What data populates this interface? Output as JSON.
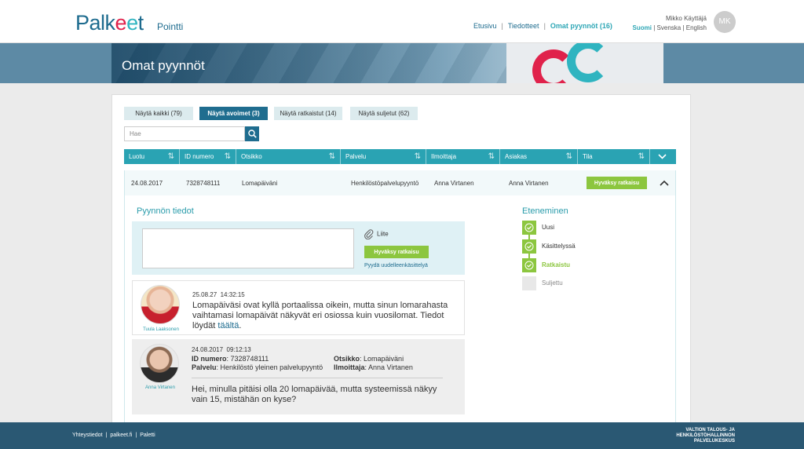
{
  "header": {
    "logo": {
      "part1": "Palk",
      "part2": "e",
      "part3": "e",
      "part4": "t"
    },
    "product": "Pointti",
    "nav": [
      {
        "label": "Etusivu"
      },
      {
        "label": "Tiedotteet"
      },
      {
        "label": "Omat pyynnöt (16)"
      }
    ],
    "user_name": "Mikko Käyttäjä",
    "languages": [
      {
        "label": "Suomi"
      },
      {
        "label": "Svenska"
      },
      {
        "label": "English"
      }
    ],
    "avatar_initials": "MK"
  },
  "banner": {
    "title": "Omat pyynnöt"
  },
  "filters": [
    {
      "label": "Näytä kaikki (79)"
    },
    {
      "label": "Näytä avoimet (3)"
    },
    {
      "label": "Näytä ratkaistut (14)"
    },
    {
      "label": "Näytä suljetut (62)"
    }
  ],
  "search": {
    "placeholder": "Hae"
  },
  "table": {
    "headers": [
      "Luotu",
      "ID numero",
      "Otsikko",
      "Palvelu",
      "Ilmoittaja",
      "Asiakas",
      "Tila"
    ],
    "row": {
      "created": "24.08.2017",
      "id": "7328748111",
      "title": "Lomapäiväni",
      "service": "Henkilöstöpalvelupyyntö",
      "reporter": "Anna Virtanen",
      "customer": "Anna Virtanen",
      "action": "Hyväksy ratkaisu"
    }
  },
  "details": {
    "title": "Pyynnön tiedot",
    "attachment": "Liite",
    "approve": "Hyväksy ratkaisu",
    "reopen": "Pyydä uudelleenkäsittelyä"
  },
  "messages": [
    {
      "author": "Tuula Laaksonen",
      "date": "25.08.27",
      "time": "14:32:15",
      "text": "Lomapäiväsi ovat kyllä portaalissa oikein, mutta sinun lomarahasta vaihtamasi lomapäivät näkyvät eri osiossa kuin vuosilomat. Tiedot löydät ",
      "link": "täältä",
      "text_end": "."
    },
    {
      "author": "Anna Virtanen",
      "date": "24.08.2017",
      "time": "09:12:13",
      "id_label": "ID numero",
      "id_value": "7328748111",
      "service_label": "Palvelu",
      "service_value": "Henkilöstö yleinen palvelupyyntö",
      "title_label": "Otsikko",
      "title_value": "Lomapäiväni",
      "reporter_label": "Ilmoittaja",
      "reporter_value": "Anna Virtanen",
      "text": "Hei, minulla pitäisi olla 20 lomapäivää, mutta systeemissä näkyy vain 15, mistähän on kyse?"
    }
  ],
  "progress": {
    "title": "Eteneminen",
    "steps": [
      {
        "label": "Uusi",
        "state": "done"
      },
      {
        "label": "Käsittelyssä",
        "state": "done"
      },
      {
        "label": "Ratkaistu",
        "state": "current"
      },
      {
        "label": "Suljettu",
        "state": "pending"
      }
    ]
  },
  "footer": {
    "links": [
      {
        "label": "Yhteystiedot"
      },
      {
        "label": "palkeet.fi"
      },
      {
        "label": "Paletti"
      }
    ],
    "org_line1": "VALTION TALOUS- JA",
    "org_line2": "HENKILÖSTÖHALLINNON",
    "org_line3": "PALVELUKESKUS"
  },
  "colors": {
    "brand": "#1d6b8e",
    "accent": "#2aa3b3",
    "success": "#8cc63f",
    "logo_red": "#e0224b"
  }
}
